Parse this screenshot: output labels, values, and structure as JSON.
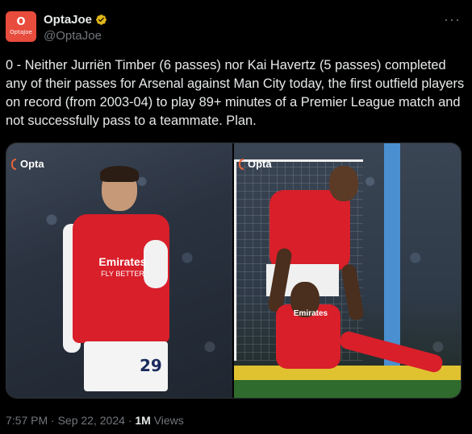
{
  "tweet": {
    "avatar_text_top": "O",
    "avatar_text_bottom": "OptaJoe",
    "display_name": "OptaJoe",
    "handle": "@OptaJoe",
    "more_label": "···",
    "text": "0 - Neither Jurriën Timber (6 passes) nor Kai Havertz (5 passes) completed any of their passes for Arsenal against Man City today, the first outfield players on record (from 2003-04) to play 89+ minutes of a Premier League match and not successfully pass to a teammate. Plan.",
    "time": "7:57 PM",
    "date": "Sep 22, 2024",
    "views_count": "1M",
    "views_label": "Views"
  },
  "media": [
    {
      "watermark": "Opta",
      "sponsor": "Emirates",
      "sponsor_sub": "FLY BETTER",
      "shirt_number": "29"
    },
    {
      "watermark": "Opta",
      "sponsor": "Emirates"
    }
  ],
  "colors": {
    "background": "#000000",
    "text": "#e7e9ea",
    "muted": "#71767b",
    "verified": "#e2b719",
    "opta_brand": "#e84c3d"
  },
  "icons": {
    "verified": "verified-badge-icon",
    "more": "more-icon"
  }
}
